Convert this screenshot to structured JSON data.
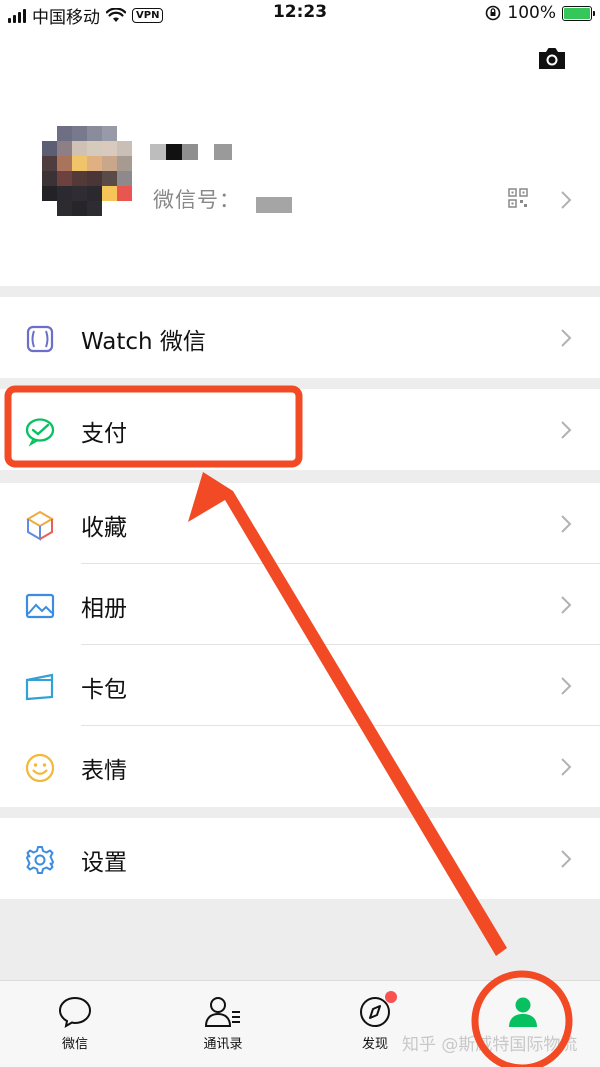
{
  "status_bar": {
    "carrier": "中国移动",
    "vpn": "VPN",
    "time": "12:23",
    "battery": "100%"
  },
  "profile": {
    "wechat_id_label": "微信号："
  },
  "menu_groups": [
    [
      {
        "label": "Watch 微信",
        "icon": "watch-icon"
      }
    ],
    [
      {
        "label": "支付",
        "icon": "pay-icon"
      }
    ],
    [
      {
        "label": "收藏",
        "icon": "favorites-cube-icon"
      },
      {
        "label": "相册",
        "icon": "album-icon"
      },
      {
        "label": "卡包",
        "icon": "card-wallet-icon"
      },
      {
        "label": "表情",
        "icon": "sticker-smile-icon"
      }
    ],
    [
      {
        "label": "设置",
        "icon": "settings-gear-icon"
      }
    ]
  ],
  "tabs": [
    {
      "label": "微信",
      "icon": "chat-bubble-icon"
    },
    {
      "label": "通讯录",
      "icon": "contacts-icon"
    },
    {
      "label": "发现",
      "icon": "compass-icon",
      "badge": true
    },
    {
      "label": "",
      "icon": "me-person-icon",
      "active": true
    }
  ],
  "watermark": "知乎 @斯威特国际物流",
  "colors": {
    "accent_green": "#07c160",
    "annotation_red": "#f24a24",
    "badge_red": "#fa5151"
  }
}
